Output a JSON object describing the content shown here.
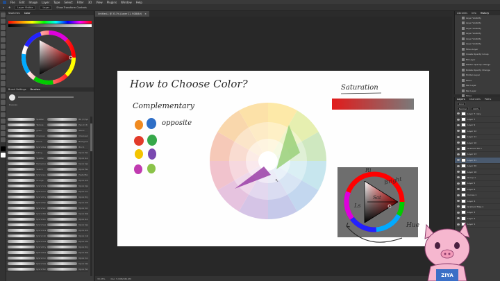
{
  "menubar": {
    "items": [
      "File",
      "Edit",
      "Image",
      "Layer",
      "Type",
      "Select",
      "Filter",
      "3D",
      "View",
      "Plugins",
      "Window",
      "Help"
    ]
  },
  "optbar": {
    "preset": "Layer Visible",
    "mode": "Layer",
    "checkbox_label": "Show Transform Controls"
  },
  "left_panel": {
    "tabs": [
      "Swatches",
      "Color"
    ],
    "brush_tabs": [
      "Brush Settings",
      "Brushes"
    ],
    "brush_group": "Leaves",
    "brushes": [
      {
        "name": "Splatter",
        "label": "B6 (3) Spray"
      },
      {
        "name": "Texture",
        "label": "Pencil (3) 1"
      },
      {
        "name": "grass",
        "label": "Stand"
      },
      {
        "name": "Charcoal",
        "label": "Charcoal (1)"
      },
      {
        "name": "Pencil",
        "label": "Background bru..."
      },
      {
        "name": "Kyle's Real Pencil",
        "label": "Blur 1"
      },
      {
        "name": "Inking",
        "label": "Kyle's Pencil – 1"
      },
      {
        "name": "Splatter",
        "label": "Kyle's Gouache..."
      },
      {
        "name": "Background",
        "label": "Kyle's Spatter"
      },
      {
        "name": "Sketch",
        "label": "Kyle's Pencil"
      },
      {
        "name": "Kyle's Gouache",
        "label": "Pastel Brush"
      },
      {
        "name": "Grunge",
        "label": "Kyle's Grain"
      },
      {
        "name": "Kyle's Shader",
        "label": "Kyle's Spatter Brushes – Splatter"
      },
      {
        "name": "Kyle's Concept",
        "label": "Kyle's Concept Brushes – Pencil"
      },
      {
        "name": "Kyle's Dry Media",
        "label": "Kyle's Dry Media – Chalk"
      },
      {
        "name": "Kyle's Pencil",
        "label": "Kyle's Ultimate Inking"
      },
      {
        "name": "Kyle's Screentones",
        "label": "Kyle's Screentones"
      },
      {
        "name": "Kyle's Watercolor",
        "label": "Kyle's Watercolor"
      },
      {
        "name": "Kyle's Gouache 2",
        "label": "Kyle's Gouache 2"
      },
      {
        "name": "Kyle's Spatter",
        "label": "Kyle's Spatter 2"
      },
      {
        "name": "Kyle's Grain 2",
        "label": "Kyle's Grain 2"
      },
      {
        "name": "Kyle's Inking",
        "label": "Kyle's Inking 2"
      },
      {
        "name": "Kyle's Shader 3",
        "label": "Kyle's Shader 3"
      },
      {
        "name": "Kyle's Dry 2",
        "label": "Kyle's Dry 2"
      },
      {
        "name": "Kyle's Real Watercolor",
        "label": "Kyle's Real Watercolor"
      },
      {
        "name": "Kyle's Concept 2",
        "label": "Kyle's Concept 2"
      },
      {
        "name": "Kyle's Sketch",
        "label": "Kyle's Sketch"
      },
      {
        "name": "Kyle's Texture",
        "label": "Kyle's Texture"
      }
    ]
  },
  "document": {
    "tab": "Untitled-1 @ 33.3% (Layer 21, RGB/8#)",
    "zoom": "33.33%",
    "doc_info": "Doc: 5.93M/182.6M"
  },
  "canvas": {
    "title": "How to Choose Color?",
    "complementary_label": "Complementary",
    "opposite_label": "opposite",
    "saturation_label": "Saturation",
    "brightness_label": "Bright",
    "sat_label": "Sat",
    "ls_label": "Ls",
    "hue_label": "Hue",
    "ref_label": "Ri"
  },
  "history_panel": {
    "tabs": [
      "Libraries",
      "Info",
      "History"
    ],
    "items": [
      "Layer Visibility",
      "Layer Visibility",
      "Layer Visibility",
      "Layer Visibility",
      "Layer Visibility",
      "Layer Visibility",
      "Move Layer",
      "Create Opacity Group",
      "Fill Layer",
      "Master Opacity Change",
      "Rotate Opacity Change",
      "Hidden Layer",
      "Move",
      "Pen Layer",
      "Pen Layer",
      "Move",
      "Free Transform"
    ]
  },
  "layers_panel": {
    "tabs": [
      "Layers",
      "Channels",
      "Paths"
    ],
    "kind_label": "Kind",
    "blend_mode": "Normal",
    "opacity": "100%",
    "fill": "100%",
    "layers": [
      "Layer 7 copy",
      "Layer 7",
      "Layer 9",
      "Layer 12",
      "Layer 11",
      "Layer 10",
      "Gradient Fill 1",
      "Layer 13",
      "Layer 21",
      "Layer 20",
      "Layer 16",
      "Group 1",
      "Layer 5",
      "Layer 6",
      "Curves 1",
      "Layer 4",
      "Gradient Map 1",
      "Layer 3",
      "Layer 2",
      "Layer 1"
    ]
  },
  "pig": {
    "apron_text": "ZIYA"
  },
  "colors": {
    "accent_red": "#e21b1b",
    "pig_pink": "#f6b7cf",
    "apron_blue": "#3b6fc6"
  }
}
